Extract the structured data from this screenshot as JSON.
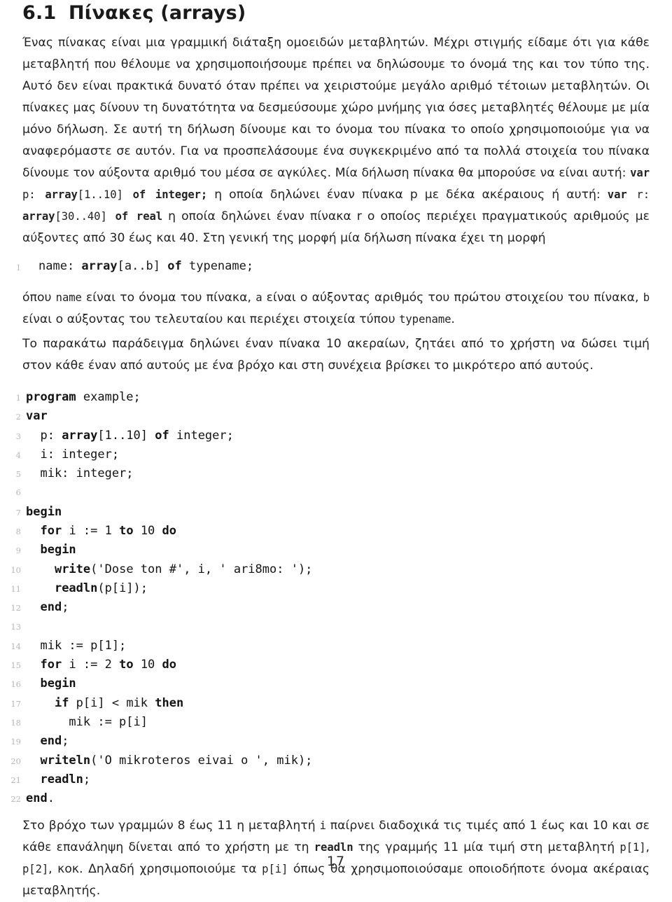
{
  "heading": {
    "number": "6.1",
    "title": "Πίνακες (arrays)"
  },
  "paragraphs": {
    "intro_part1": "Ένας πίνακας είναι μια γραμμική διάταξη ομοειδών μεταβλητών. Μέχρι στιγμής είδαμε ότι για κάθε μεταβλητή που θέλουμε να χρησιμοποιήσουμε πρέπει να δηλώσουμε το όνομά της και τον τύπο της. Αυτό δεν είναι πρακτικά δυνατό όταν πρέπει να χειριστούμε μεγάλο αριθμό τέτοιων μεταβλητών. Οι πίνακες μας δίνουν τη δυνατότητα να δεσμεύσουμε χώρο μνήμης για όσες μεταβλητές θέλουμε με μία μόνο δήλωση. Σε αυτή τη δήλωση δίνουμε και το όνομα του πίνακα το οποίο χρησιμοποιούμε για να αναφερόμαστε σε αυτόν. Για να προσπελάσουμε ένα συγκεκριμένο από τα πολλά στοιχεία του πίνακα δίνουμε τον αύξοντα αριθμό του μέσα σε αγκύλες. Μία δήλωση πίνακα θα μπορούσε να είναι αυτή:",
    "decl_p_var": "var",
    "decl_p_name": " p: ",
    "decl_p_array": "array",
    "decl_p_range": "[1..10] ",
    "decl_p_of": "of",
    "decl_p_type": " integer;",
    "after_decl_p": " η οποία δηλώνει έναν πίνακα p με δέκα ακέραιους ή αυτή:",
    "decl_r_var": "var",
    "decl_r_name": " r: ",
    "decl_r_array": "array",
    "decl_r_range": "[30..40] ",
    "decl_r_of": "of",
    "decl_r_type": " real",
    "after_decl_r": " η οποία δηλώνει έναν πίνακα r ο οποίος περιέχει πραγματικούς αριθμούς με αύξοντες από 30 έως και 40. Στη γενική της μορφή μία δήλωση πίνακα έχει τη μορφή",
    "explain_p1_a": "όπου ",
    "explain_p1_name": "name",
    "explain_p1_b": " είναι το όνομα του πίνακα, ",
    "explain_p1_a_var": "a",
    "explain_p1_c": " είναι ο αύξοντας αριθμός του πρώτου στοιχείου του πίνακα, ",
    "explain_p1_b_var": "b",
    "explain_p1_d": " είναι ο αύξοντας του τελευταίου και περιέχει στοιχεία τύπου ",
    "explain_p1_typename": "typename",
    "explain_p1_e": ".",
    "explain_p2": "Το παρακάτω παράδειγμα δηλώνει έναν πίνακα 10 ακεραίων, ζητάει από το χρήστη να δώσει τιμή στον κάθε έναν από αυτούς με ένα βρόχο και στη συνέχεια βρίσκει το μικρότερο από αυτούς.",
    "final_a": "Στο βρόχο των γραμμών 8 έως 11 η μεταβλητή ",
    "final_i": "i",
    "final_b": " παίρνει διαδοχικά τις τιμές από 1 έως και 10 και σε κάθε επανάληψη δίνεται από το χρήστη με τη ",
    "final_readln": "readln",
    "final_c": " της γραμμής 11 μία τιμή στη μεταβλητή ",
    "final_p1": "p[1]",
    "final_d": ", ",
    "final_p2": "p[2]",
    "final_e": ", κοκ. Δηλαδή χρησιμοποιούμε τα ",
    "final_pi": "p[i]",
    "final_f": " όπως θα χρησιμοποιούσαμε οποιοδήποτε όνομα ακέραιας μεταβλητής."
  },
  "syntax_line": {
    "number": "1",
    "pre": "name: ",
    "kw_array": "array",
    "range": "[a..b] ",
    "kw_of": "of",
    "post": " typename;"
  },
  "listing": {
    "lines": [
      {
        "n": "1",
        "text": "program example;",
        "bold": "program"
      },
      {
        "n": "2",
        "text": "var",
        "bold": "var"
      },
      {
        "n": "3",
        "text": "  p: array[1..10] of integer;",
        "bold": "array of"
      },
      {
        "n": "4",
        "text": "  i: integer;",
        "bold": ""
      },
      {
        "n": "5",
        "text": "  mik: integer;",
        "bold": ""
      },
      {
        "n": "6",
        "text": "",
        "bold": ""
      },
      {
        "n": "7",
        "text": "begin",
        "bold": "begin"
      },
      {
        "n": "8",
        "text": "  for i := 1 to 10 do",
        "bold": "for to do"
      },
      {
        "n": "9",
        "text": "  begin",
        "bold": "begin"
      },
      {
        "n": "10",
        "text": "    write('Dose ton #', i, ' ari8mo: ');",
        "bold": "write"
      },
      {
        "n": "11",
        "text": "    readln(p[i]);",
        "bold": "readln"
      },
      {
        "n": "12",
        "text": "  end;",
        "bold": "end"
      },
      {
        "n": "13",
        "text": "",
        "bold": ""
      },
      {
        "n": "14",
        "text": "  mik := p[1];",
        "bold": ""
      },
      {
        "n": "15",
        "text": "  for i := 2 to 10 do",
        "bold": "for to do"
      },
      {
        "n": "16",
        "text": "  begin",
        "bold": "begin"
      },
      {
        "n": "17",
        "text": "    if p[i] < mik then",
        "bold": "if then"
      },
      {
        "n": "18",
        "text": "      mik := p[i]",
        "bold": ""
      },
      {
        "n": "19",
        "text": "  end;",
        "bold": "end"
      },
      {
        "n": "20",
        "text": "  writeln('O mikroteros eivai o ', mik);",
        "bold": "writeln"
      },
      {
        "n": "21",
        "text": "  readln;",
        "bold": "readln"
      },
      {
        "n": "22",
        "text": "end.",
        "bold": "end"
      }
    ]
  },
  "footer": {
    "page_number": "17"
  },
  "colors": {
    "text": "#1a1a1a",
    "body_text": "#232323",
    "line_number": "#b6b6b6",
    "background": "#ffffff"
  }
}
